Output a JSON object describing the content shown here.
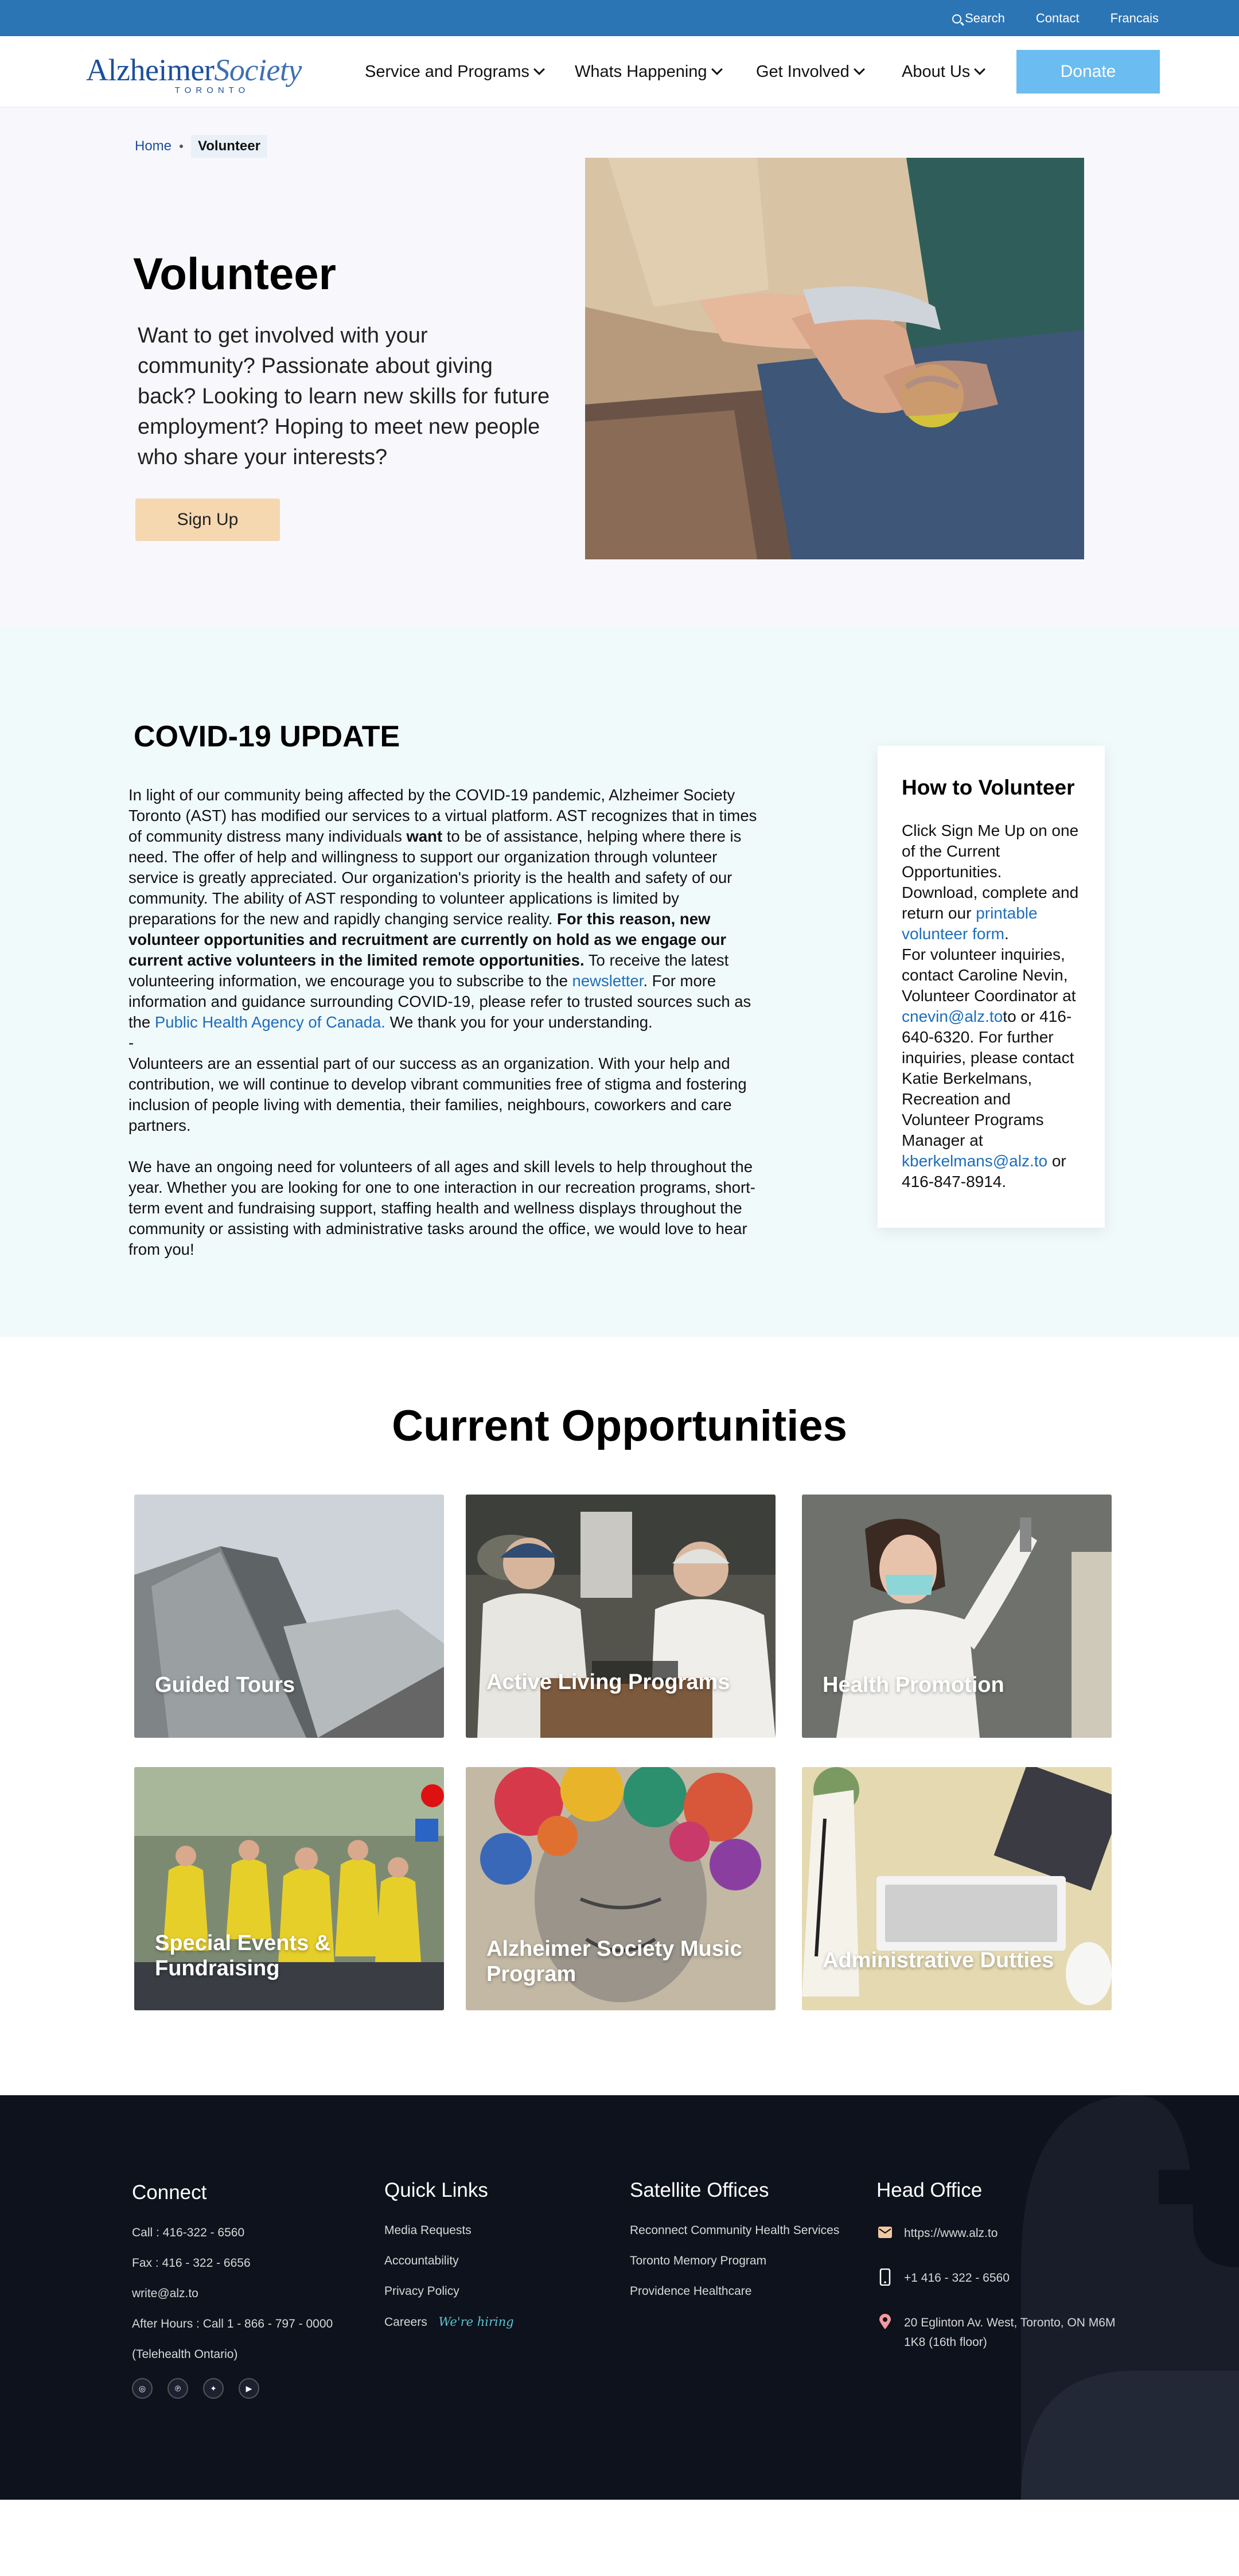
{
  "topbar": {
    "search": "Search",
    "contact": "Contact",
    "francais": "Francais"
  },
  "logo": {
    "main": "Alzheimer",
    "italic": "Society",
    "sub": "TORONTO"
  },
  "nav": [
    "Service and Programs",
    "Whats Happening",
    "Get Involved",
    "About Us"
  ],
  "donate": "Donate",
  "breadcrumb": {
    "home": "Home",
    "current": "Volunteer"
  },
  "hero": {
    "title": "Volunteer",
    "intro": "Want to get involved with your community? Passionate about giving back? Looking to learn new skills for future employment? Hoping to meet new people who share your interests?",
    "signup": "Sign Up"
  },
  "covid": {
    "title": "COVID-19 UPDATE",
    "p1a": "In light of our community being affected by the COVID-19 pandemic, Alzheimer Society Toronto (AST) has modified our services to a virtual platform. AST recognizes that in times of community distress many individuals ",
    "p1want": "want",
    "p1b": " to be of assistance, helping where there is need. The offer of help and willingness to support our organization through volunteer service is greatly appreciated. Our organization's priority is the health and safety of our community. The ability of AST responding to volunteer applications is limited by preparations for the new and rapidly changing service reality. ",
    "p1bold": "For this reason, new volunteer opportunities and recruitment are currently on hold as we engage our current active volunteers in the limited remote opportunities.",
    "p1c": " To receive the latest volunteering information, we encourage you to subscribe to the ",
    "newsletter": "newsletter",
    "p1d": ". For more information and guidance surrounding COVID-19, please refer to trusted sources such as the ",
    "phac": "Public Health Agency of Canada.",
    "p1e": " We thank you for your understanding.",
    "dash": "-",
    "p2": "Volunteers are an essential part of our success as an organization. With your help and contribution, we will continue to develop vibrant communities free of stigma and fostering inclusion of people living with dementia, their families, neighbours, coworkers and care partners.",
    "p3": "We have an ongoing need for volunteers of all ages and skill levels to help throughout the year. Whether you are looking for one to one interaction in our recreation programs, short-term event and fundraising support, staffing health and wellness displays throughout the community or assisting with administrative tasks around the office, we would love to hear from you!"
  },
  "how": {
    "title": "How to Volunteer",
    "t1": "Click Sign Me Up on one of the Current Opportunities. Download, complete and return our ",
    "form": "printable volunteer form",
    "t2": ".",
    "t3": "For volunteer inquiries, contact Caroline Nevin, Volunteer Coordinator at ",
    "email1": "cnevin@alz.to",
    "t4": "to or 416-640-6320. For further inquiries, please contact Katie Berkelmans, Recreation and Volunteer Programs Manager at ",
    "email2": "kberkelmans@alz.to",
    "t5": " or 416-847-8914."
  },
  "opportunities": {
    "title": "Current Opportunities",
    "cards": [
      "Guided Tours",
      "Active Living Programs",
      "Health Promotion",
      "Special Events & Fundraising",
      "Alzheimer Society Music Program",
      "Administrative Dutties"
    ]
  },
  "footer": {
    "connect": {
      "title": "Connect",
      "items": [
        "Call : 416-322 - 6560",
        "Fax : 416 - 322 - 6656",
        "write@alz.to",
        "After Hours : Call 1 - 866 - 797 - 0000",
        "(Telehealth Ontario)"
      ]
    },
    "quick": {
      "title": "Quick Links",
      "items": [
        "Media Requests",
        "Accountability",
        "Privacy Policy",
        "Careers"
      ],
      "hiring": "We're hiring"
    },
    "satellite": {
      "title": "Satellite Offices",
      "items": [
        "Reconnect Community Health Services",
        "Toronto Memory Program",
        "Providence Healthcare"
      ]
    },
    "head": {
      "title": "Head Office",
      "web": "https://www.alz.to",
      "phone": "+1 416 - 322 - 6560",
      "address": "20 Eglinton Av. West, Toronto, ON M6M 1K8 (16th floor)"
    }
  },
  "colors": {
    "topbar": "#2c75b5",
    "donate": "#6bbcf0",
    "signup": "#f5d7b0",
    "covid_bg": "#f1fafb",
    "footer": "#0d121c",
    "link": "#1d6dbd"
  }
}
